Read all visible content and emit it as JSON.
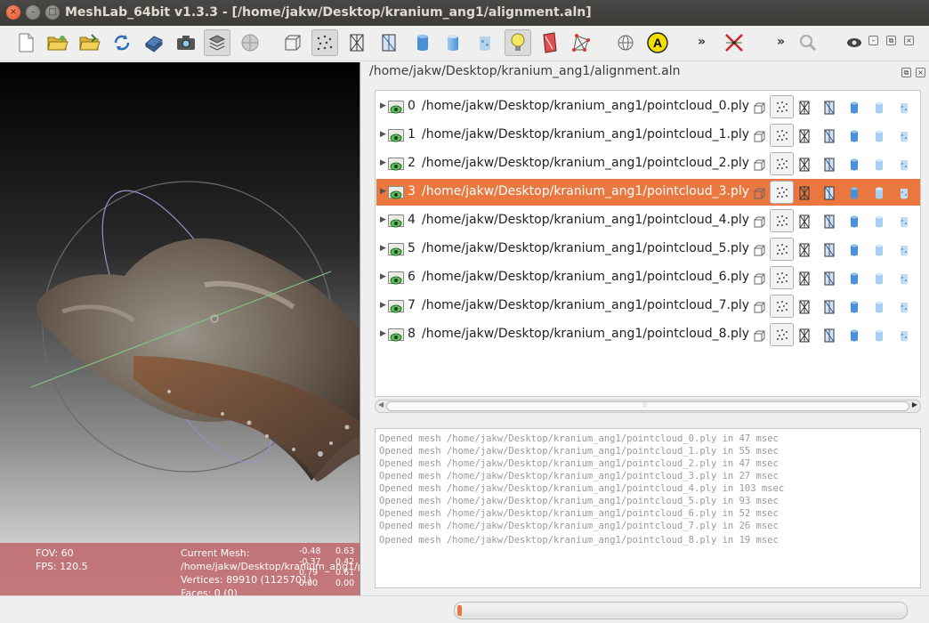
{
  "window": {
    "title": "MeshLab_64bit v1.3.3 - [/home/jakw/Desktop/kranium_ang1/alignment.aln]",
    "close_glyph": "×",
    "minimize_glyph": "–",
    "maximize_glyph": "□"
  },
  "toolbar": {
    "icons": [
      "new-project-icon",
      "open-mesh-icon",
      "open-project-icon",
      "reload-icon",
      "save-icon",
      "snapshot-icon",
      "layers-icon",
      "texture-icon",
      "bounding-box-icon",
      "points-icon",
      "wireframe-icon",
      "hidden-lines-icon",
      "flat-shading-icon",
      "smooth-shading-icon",
      "texture-shading-icon",
      "light-icon",
      "double-light-icon",
      "select-faces-icon",
      "trackball-icon",
      "annotation-icon",
      "edit-align-icon",
      "search-icon",
      "raw-view-icon"
    ],
    "more_glyph": "»",
    "annotation_letter": "A"
  },
  "viewport": {
    "fov_label": "FOV: 60",
    "fps_label": "FPS:   120.5",
    "current_mesh_label": "Current Mesh:",
    "mesh_path": "/home/jakw/Desktop/kranium_ang1/po",
    "vertices": "Vertices: 89910 (1125701)",
    "faces": "Faces: 0 (0)",
    "matrix": [
      [
        "-0.48",
        "0.63"
      ],
      [
        "-0.37",
        "0.42"
      ],
      [
        "0.79",
        "0.61"
      ],
      [
        "0.00",
        "0.00"
      ]
    ]
  },
  "dock": {
    "title": "/home/jakw/Desktop/kranium_ang1/alignment.aln",
    "float_glyph": "⧉",
    "close_glyph": "×"
  },
  "layers": [
    {
      "index": "0",
      "path": "/home/jakw/Desktop/kranium_ang1/pointcloud_0.ply",
      "selected": false
    },
    {
      "index": "1",
      "path": "/home/jakw/Desktop/kranium_ang1/pointcloud_1.ply",
      "selected": false
    },
    {
      "index": "2",
      "path": "/home/jakw/Desktop/kranium_ang1/pointcloud_2.ply",
      "selected": false
    },
    {
      "index": "3",
      "path": "/home/jakw/Desktop/kranium_ang1/pointcloud_3.ply",
      "selected": true
    },
    {
      "index": "4",
      "path": "/home/jakw/Desktop/kranium_ang1/pointcloud_4.ply",
      "selected": false
    },
    {
      "index": "5",
      "path": "/home/jakw/Desktop/kranium_ang1/pointcloud_5.ply",
      "selected": false
    },
    {
      "index": "6",
      "path": "/home/jakw/Desktop/kranium_ang1/pointcloud_6.ply",
      "selected": false
    },
    {
      "index": "7",
      "path": "/home/jakw/Desktop/kranium_ang1/pointcloud_7.ply",
      "selected": false
    },
    {
      "index": "8",
      "path": "/home/jakw/Desktop/kranium_ang1/pointcloud_8.ply",
      "selected": false
    }
  ],
  "row_icons": [
    "bbox-icon",
    "points-mode-icon",
    "wireframe-mode-icon",
    "hidden-lines-mode-icon",
    "flat-mode-icon",
    "smooth-mode-icon",
    "texture-mode-icon"
  ],
  "scrollbar": {
    "left_arrow": "◀",
    "right_arrow": "▶",
    "grip": "⦙⦙⦙"
  },
  "log": [
    "Opened mesh /home/jakw/Desktop/kranium_ang1/pointcloud_0.ply in 47 msec",
    "Opened mesh /home/jakw/Desktop/kranium_ang1/pointcloud_1.ply in 55 msec",
    "Opened mesh /home/jakw/Desktop/kranium_ang1/pointcloud_2.ply in 47 msec",
    "Opened mesh /home/jakw/Desktop/kranium_ang1/pointcloud_3.ply in 27 msec",
    "Opened mesh /home/jakw/Desktop/kranium_ang1/pointcloud_4.ply in 103 msec",
    "Opened mesh /home/jakw/Desktop/kranium_ang1/pointcloud_5.ply in 93 msec",
    "Opened mesh /home/jakw/Desktop/kranium_ang1/pointcloud_6.ply in 52 msec",
    "Opened mesh /home/jakw/Desktop/kranium_ang1/pointcloud_7.ply in 26 msec",
    "Opened mesh /home/jakw/Desktop/kranium_ang1/pointcloud_8.ply in 19 msec"
  ],
  "status": {
    "progress_fraction": 0.01
  },
  "colors": {
    "selection": "#e9773f",
    "info_panel": "#be6469",
    "title_bar": "#3c3b37"
  }
}
